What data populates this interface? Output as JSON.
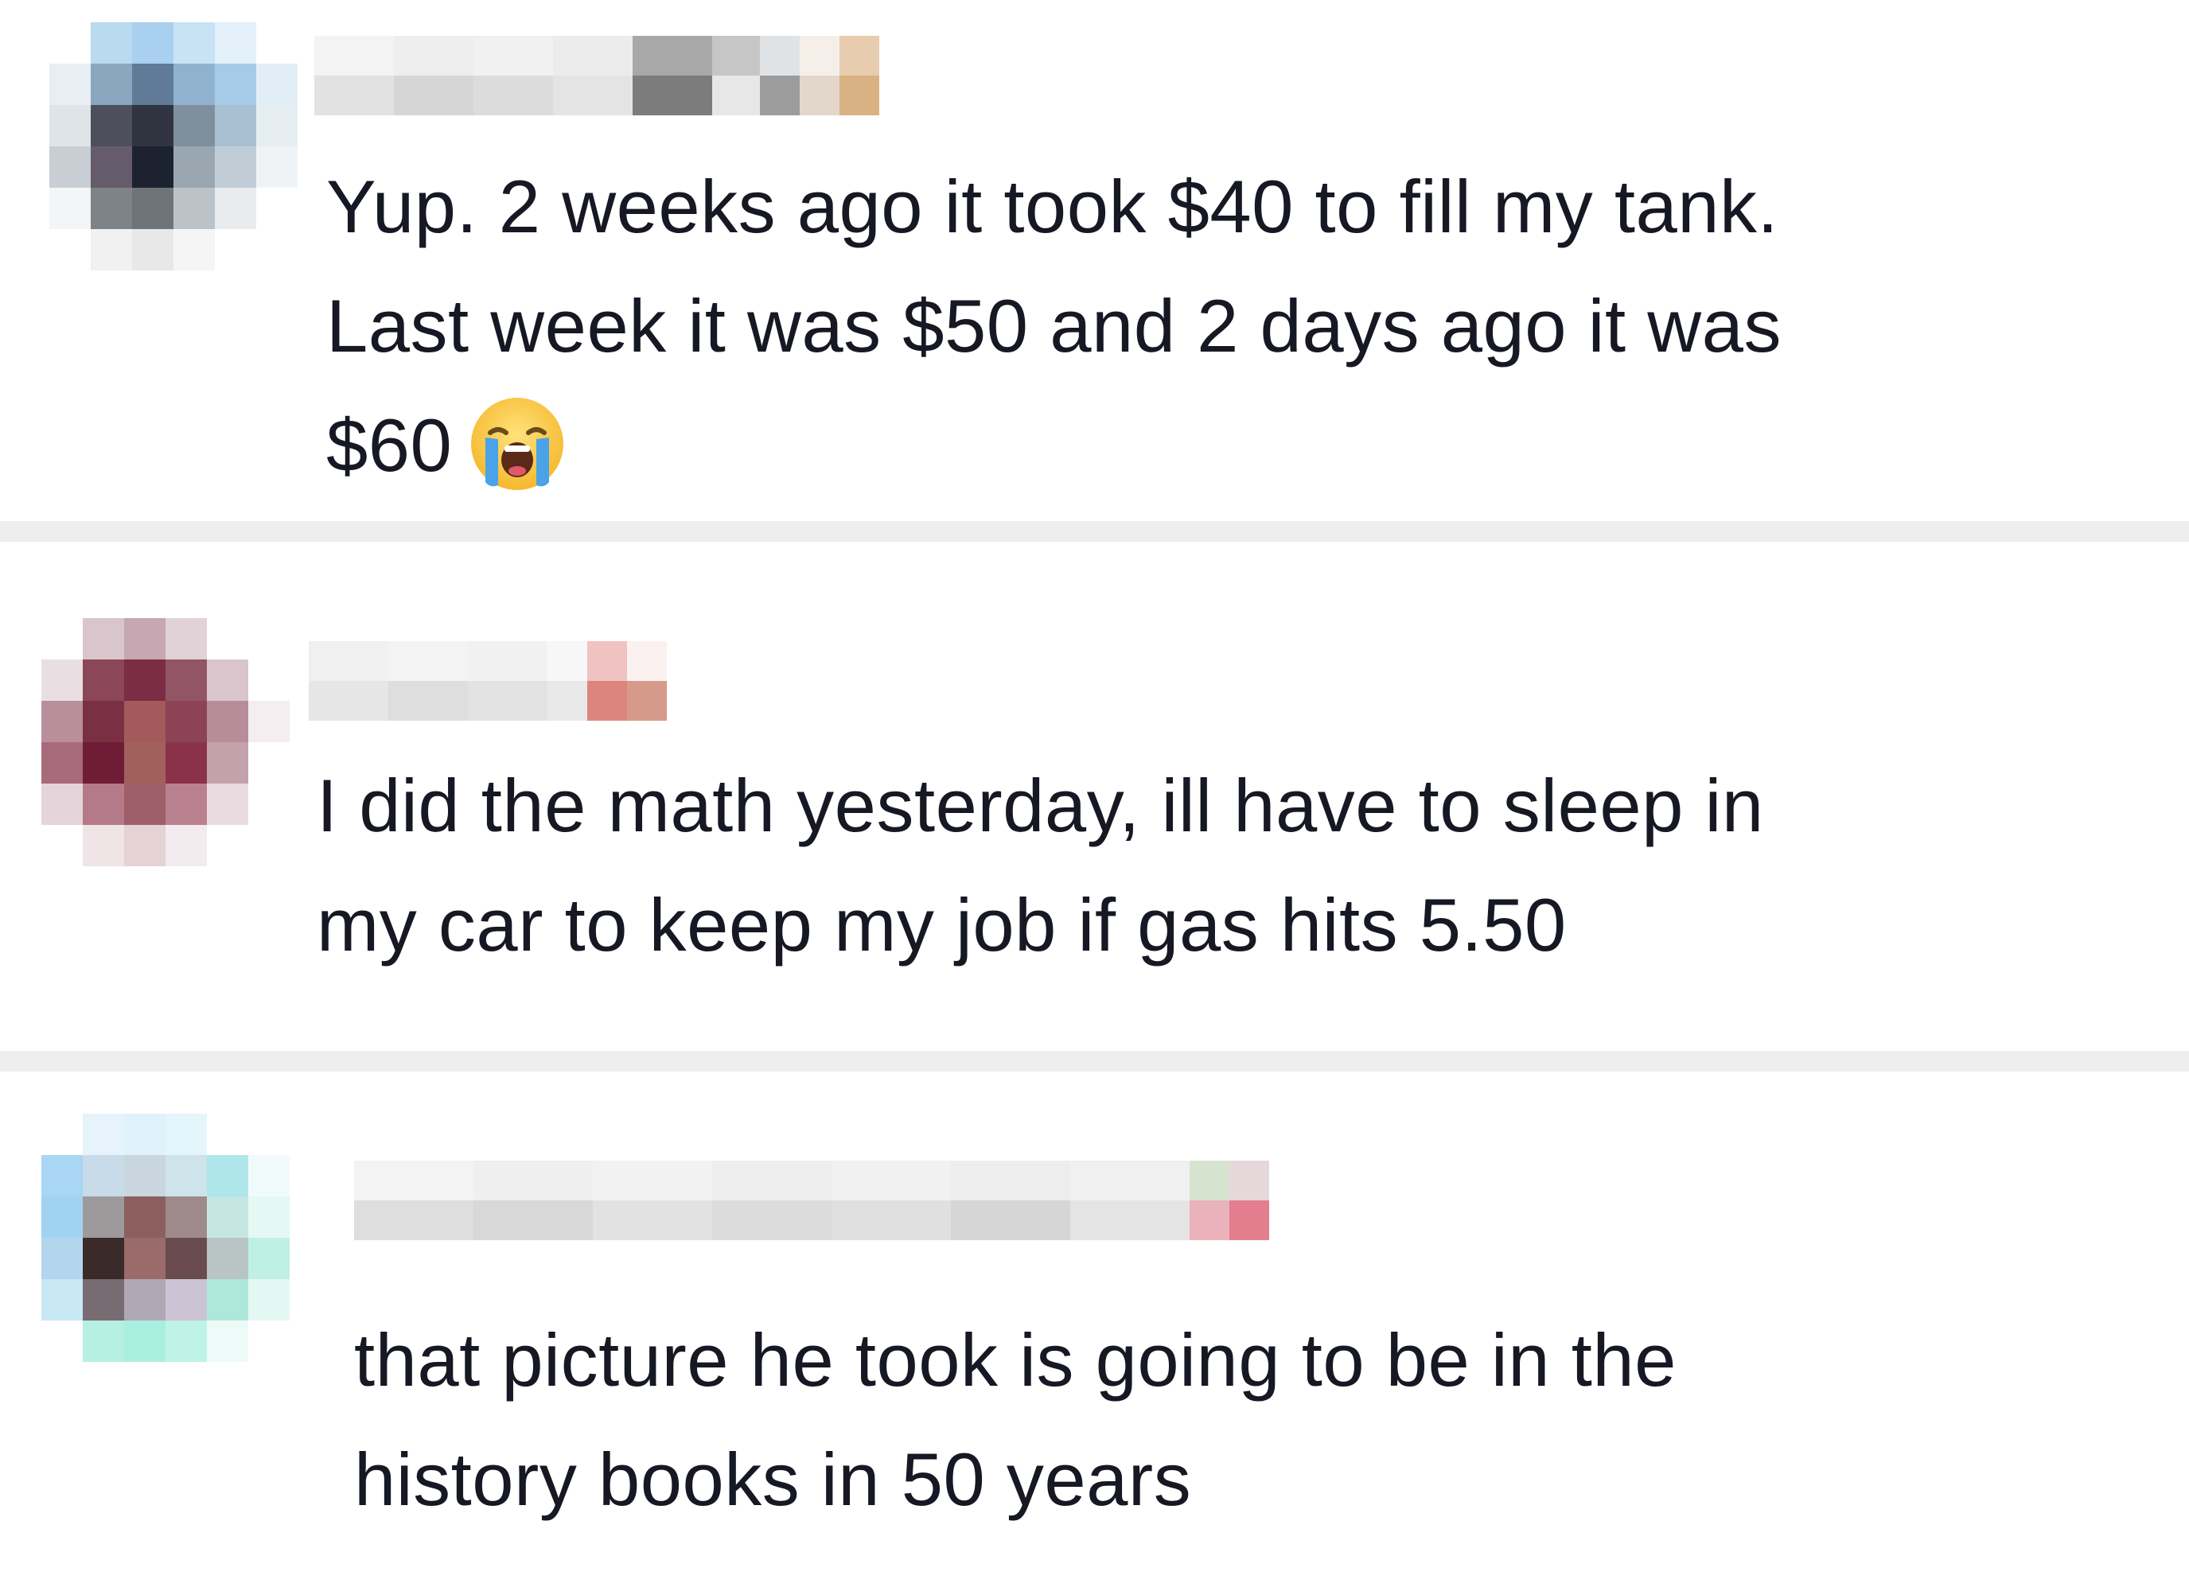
{
  "comments": [
    {
      "text_lines": [
        "Yup. 2 weeks ago it took $40 to fill my tank.",
        "Last week it was $50 and 2 days ago it was",
        "$60"
      ],
      "emoji": "loudly-crying-face-icon"
    },
    {
      "text_lines": [
        "I did the math yesterday, ill have to sleep in",
        "my car to keep my job if gas hits 5.50"
      ]
    },
    {
      "text_lines": [
        "that picture he took is going to be in the",
        "history books in 50 years"
      ]
    }
  ],
  "colors": {
    "divider": "#eeeeee",
    "text": "#161823",
    "background": "#ffffff"
  }
}
